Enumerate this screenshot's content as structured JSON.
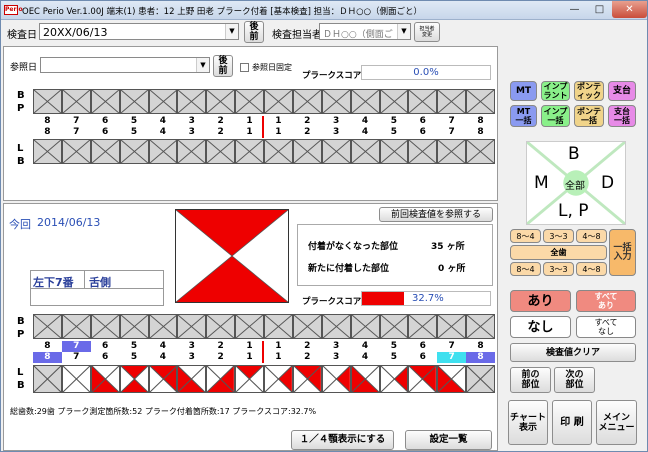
{
  "titlebar": {
    "icon": "Perio",
    "text": "OEC Perio  Ver.1.00J  端末(1)   患者：12 上野  田老   プラーク付着   [基本検査]   担当：ＤＨ○○（側面ごと）"
  },
  "header": {
    "exam_date_label": "検査日",
    "exam_date_value": "20XX/06/13",
    "nav_btn": "後\n前",
    "examiner_label": "検査担当者",
    "examiner_value": "ＤＨ○○（側面ご",
    "examiner_change_btn": "担当者\n変更"
  },
  "top": {
    "ref_date_label": "参照日",
    "ref_date_value": "",
    "nav_btn": "後\n前",
    "fix_label": "参照日固定",
    "score_label": "プラークスコア",
    "score_value": "0.0%"
  },
  "teeth": {
    "upper_nums": [
      "8",
      "7",
      "6",
      "5",
      "4",
      "3",
      "2",
      "1",
      "1",
      "2",
      "3",
      "4",
      "5",
      "6",
      "7",
      "8"
    ],
    "lower_nums": [
      "8",
      "7",
      "6",
      "5",
      "4",
      "3",
      "2",
      "1",
      "1",
      "2",
      "3",
      "4",
      "5",
      "6",
      "7",
      "8"
    ],
    "side_bp": "B\nP",
    "side_lb": "L\nB"
  },
  "bottom": {
    "today_label": "今回",
    "today_date": "2014/06/13",
    "ref_btn": "前回検査値を参照する",
    "lost_label": "付着がなくなった部位",
    "lost_value": "35 ヶ所",
    "new_label": "新たに付着した部位",
    "new_value": "0 ヶ所",
    "tooth_name": "左下7番",
    "side_name": "舌側",
    "score_label": "プラークスコア",
    "score_value": "32.7%",
    "score_percent": 32.7,
    "stats": "総歯数:29歯  プラーク測定箇所数:52  プラーク付着箇所数:17  プラークスコア:32.7%",
    "quarter_btn": "１／４顎表示にする",
    "settings_btn": "設定一覧"
  },
  "right": {
    "row1": [
      "MT",
      "インプ\nラント",
      "ポンテ\nィック",
      "支台"
    ],
    "row2": [
      "MT\n一括",
      "インプ\n一括",
      "ポンテ\n一括",
      "支台\n一括"
    ],
    "dir": {
      "b": "B",
      "m": "M",
      "d": "D",
      "lp": "L, P",
      "all": "全部"
    },
    "range_top": [
      "8～4",
      "3～3",
      "4～8"
    ],
    "all_teeth": "全歯",
    "range_bottom": [
      "8～4",
      "3～3",
      "4～8"
    ],
    "bulk_input": "一括\n入力",
    "ari": "あり",
    "all_ari": "すべて\nあり",
    "nashi": "なし",
    "all_nashi": "すべて\nなし",
    "clear": "検査値クリア",
    "prev_site": "前の\n部位",
    "next_site": "次の\n部位",
    "chart_view": "チャート\n表示",
    "print": "印 刷",
    "main_menu": "メイン\nメニュー"
  },
  "colors": {
    "plaque_red": "#ee0000",
    "blue_tooth": "#6a6ae8",
    "cyan_tooth": "#3fe0ef"
  },
  "plaque_cells": [
    [
      0,
      0,
      0,
      0
    ],
    [
      0,
      0,
      0,
      0
    ],
    [
      1,
      0,
      0,
      1
    ],
    [
      0,
      1,
      0,
      1
    ],
    [
      0,
      1,
      1,
      0
    ],
    [
      1,
      0,
      0,
      1
    ],
    [
      0,
      0,
      1,
      1
    ],
    [
      0,
      1,
      0,
      0
    ],
    [
      0,
      0,
      1,
      0
    ],
    [
      0,
      1,
      1,
      0
    ],
    [
      0,
      0,
      1,
      0
    ],
    [
      1,
      0,
      0,
      1
    ],
    [
      0,
      0,
      1,
      0
    ],
    [
      0,
      1,
      1,
      0
    ],
    [
      1,
      0,
      0,
      1
    ],
    [
      0,
      0,
      0,
      0
    ]
  ]
}
